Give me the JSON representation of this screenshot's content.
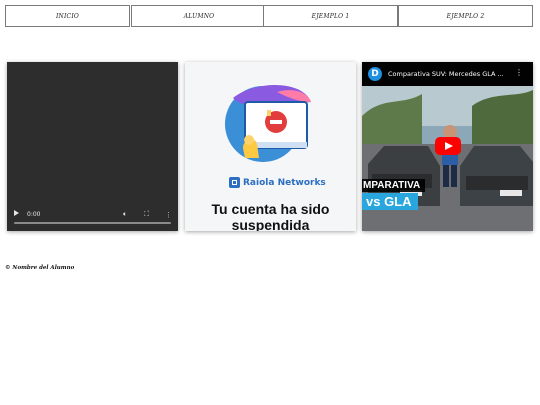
{
  "nav": {
    "items": [
      {
        "label": "INICIO"
      },
      {
        "label": "ALUMNO"
      },
      {
        "label": "EJEMPLO 1"
      },
      {
        "label": "EJEMPLO 2"
      }
    ]
  },
  "video_player": {
    "time": "0:00",
    "icons": [
      "play-icon",
      "volume-icon",
      "fullscreen-icon",
      "more-icon"
    ],
    "progress": 0
  },
  "suspended_embed": {
    "brand": "Raiola Networks",
    "message": "Tu cuenta ha sido suspendida",
    "colors": {
      "brand": "#2b6ec2"
    }
  },
  "youtube_embed": {
    "channel_initial": "D",
    "title": "Comparativa SUV: Mercedes GLA ...",
    "caption_line1": "MPARATIVA",
    "caption_line2": "vs GLA",
    "colors": {
      "play": "#ff0000",
      "caption": "#2aa6de"
    }
  },
  "footer": {
    "text": "© Nombre del Alumno"
  }
}
